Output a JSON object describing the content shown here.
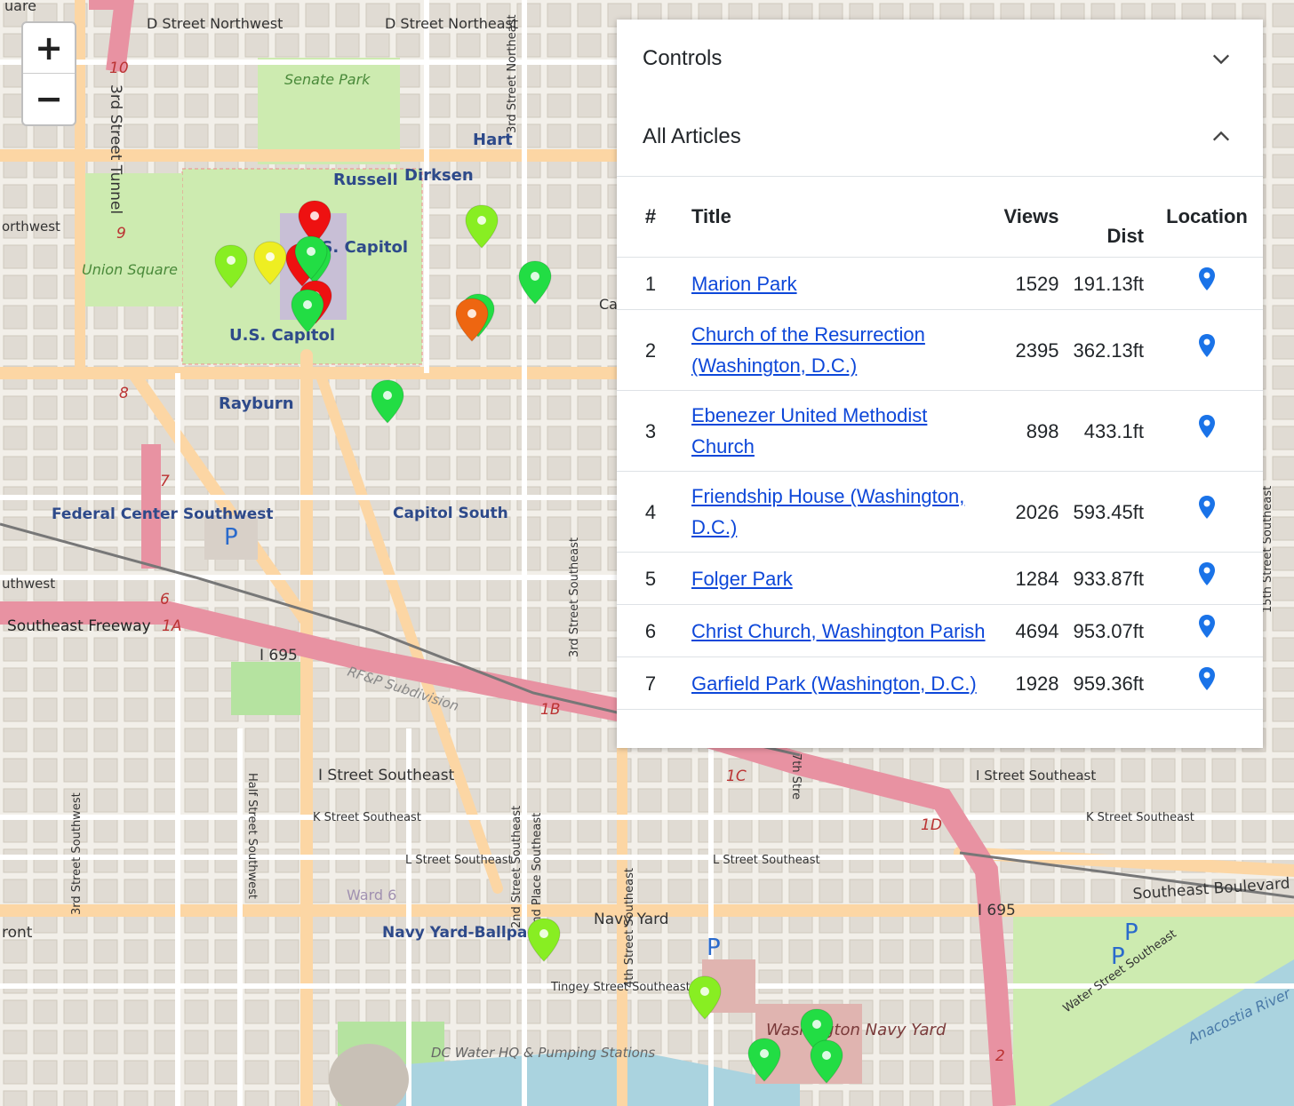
{
  "zoom": {
    "in_label": "+",
    "out_label": "−"
  },
  "map_labels": {
    "square_top": "uare",
    "d_st_nw": "D Street Northwest",
    "d_st_ne": "D Street Northeast",
    "senate_park": "Senate Park",
    "hart": "Hart",
    "russell": "Russell",
    "dirksen": "Dirksen",
    "capitol_top": "U.S. Capitol",
    "capitol_bottom": "U.S. Capitol",
    "union_square": "Union Square",
    "rayburn": "Rayburn",
    "federal_center": "Federal Center Southwest",
    "capitol_south": "Capitol South",
    "southeast_freeway": "Southeast Freeway",
    "i695_a": "I 695",
    "i695_b": "I 695",
    "rfp": "RF&P Subdivision",
    "i_st_se": "I Street Southeast",
    "i_st_se_2": "I Street Southeast",
    "k_st_se": "K Street Southeast",
    "k_st_se_2": "K Street Southeast",
    "l_st_se": "L Street Southeast",
    "l_st_se_2": "L Street Southeast",
    "navy_yard": "Navy Yard",
    "navy_yard_ballpark": "Navy Yard-Ballpark",
    "tingey": "Tingey Street Southeast",
    "washington_navy_yard": "Washington Navy Yard",
    "dc_water": "DC Water HQ & Pumping Stations",
    "se_boulevard": "Southeast Boulevard",
    "water_st": "Water Street Southeast",
    "anacostia": "Anacostia River",
    "third_st_tunnel": "3rd Street Tunnel",
    "third_st_ne": "3rd Street Northeast",
    "third_st_se": "3rd Street Southeast",
    "fourth_st_se": "4th Street Southeast",
    "second_st_se": "2nd Street Southeast",
    "second_pl_se": "2nd Place Southeast",
    "half_st_sw": "Half Street Southwest",
    "third_st_sw": "3rd Street Southwest",
    "seventh_st": "7th Stre",
    "fifteenth_se": "15th Street Southeast",
    "northwest": "orthwest",
    "thwest": "uthwest",
    "ward6": "Ward 6",
    "ront": "ront",
    "ca": "Ca",
    "exit_10": "10",
    "exit_9": "9",
    "exit_8": "8",
    "exit_7": "7",
    "exit_6": "6",
    "exit_1a": "1A",
    "exit_1b": "1B",
    "exit_1c": "1C",
    "exit_1d": "1D",
    "exit_2": "2",
    "parking": "P"
  },
  "panel": {
    "controls_label": "Controls",
    "all_articles_label": "All Articles",
    "headers": {
      "num": "#",
      "title": "Title",
      "views": "Views",
      "dist": "Dist",
      "location": "Location"
    },
    "rows": [
      {
        "num": "1",
        "title": "Marion Park",
        "views": "1529",
        "dist": "191.13ft"
      },
      {
        "num": "2",
        "title": "Church of the Resurrection (Washington, D.C.)",
        "views": "2395",
        "dist": "362.13ft"
      },
      {
        "num": "3",
        "title": "Ebenezer United Methodist Church",
        "views": "898",
        "dist": "433.1ft"
      },
      {
        "num": "4",
        "title": "Friendship House (Washington, D.C.)",
        "views": "2026",
        "dist": "593.45ft"
      },
      {
        "num": "5",
        "title": "Folger Park",
        "views": "1284",
        "dist": "933.87ft"
      },
      {
        "num": "6",
        "title": "Christ Church, Washington Parish",
        "views": "4694",
        "dist": "953.07ft"
      },
      {
        "num": "7",
        "title": "Garfield Park (Washington, D.C.)",
        "views": "1928",
        "dist": "959.36ft"
      }
    ]
  },
  "colors": {
    "pin_green": "#22dd44",
    "pin_lime": "#88ee22",
    "pin_yellow": "#eeee22",
    "pin_red": "#ee1111",
    "pin_orange": "#ee6611",
    "location_blue": "#1a73e8"
  }
}
